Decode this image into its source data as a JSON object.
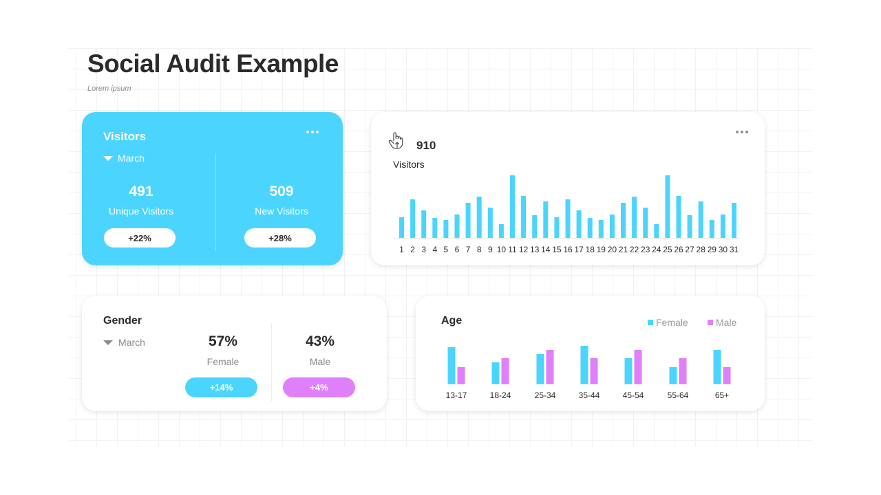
{
  "header": {
    "title": "Social Audit Example",
    "subtitle": "Lorem ipsum"
  },
  "colors": {
    "cyan": "#4bd5fe",
    "magenta": "#df80fa",
    "text_dark": "#2b2b2b",
    "text_muted": "#8a8a8a"
  },
  "visitors_card": {
    "title": "Visitors",
    "month": "March",
    "menu_icon": "more-horizontal-icon",
    "unique": {
      "value": "491",
      "label": "Unique Visitors",
      "change": "+22%"
    },
    "new": {
      "value": "509",
      "label": "New Visitors",
      "change": "+28%"
    }
  },
  "daily_card": {
    "icon": "hand-pointer-up-icon",
    "total": "910",
    "label": "Visitors",
    "menu_icon": "more-horizontal-icon"
  },
  "gender_card": {
    "title": "Gender",
    "month": "March",
    "female": {
      "value": "57%",
      "label": "Female",
      "change": "+14%"
    },
    "male": {
      "value": "43%",
      "label": "Male",
      "change": "+4%"
    }
  },
  "age_card": {
    "title": "Age",
    "legend": [
      {
        "label": "Female",
        "color": "#4bd5fe"
      },
      {
        "label": "Male",
        "color": "#df80fa"
      }
    ]
  },
  "chart_data": [
    {
      "type": "bar",
      "title": "Visitors",
      "xlabel": "",
      "ylabel": "",
      "categories": [
        "1",
        "2",
        "3",
        "4",
        "5",
        "6",
        "7",
        "8",
        "9",
        "10",
        "11",
        "12",
        "13",
        "14",
        "15",
        "16",
        "17",
        "18",
        "19",
        "20",
        "21",
        "22",
        "23",
        "24",
        "25",
        "26",
        "27",
        "28",
        "29",
        "30",
        "31"
      ],
      "values": [
        30,
        56,
        40,
        29,
        26,
        34,
        51,
        60,
        44,
        20,
        91,
        61,
        33,
        53,
        30,
        56,
        40,
        29,
        26,
        34,
        51,
        60,
        44,
        20,
        91,
        61,
        33,
        53,
        26,
        34,
        51
      ],
      "ylim": [
        0,
        91
      ],
      "grid": false,
      "color": "#4bd5fe"
    },
    {
      "type": "bar",
      "title": "Age",
      "xlabel": "",
      "ylabel": "",
      "categories": [
        "13-17",
        "18-24",
        "25-34",
        "35-44",
        "45-54",
        "55-64",
        "65+"
      ],
      "series": [
        {
          "name": "Female",
          "color": "#4bd5fe",
          "values": [
            54,
            32,
            44,
            56,
            38,
            25,
            50
          ]
        },
        {
          "name": "Male",
          "color": "#df80fa",
          "values": [
            25,
            38,
            50,
            38,
            50,
            38,
            25
          ]
        }
      ],
      "ylim": [
        0,
        56
      ],
      "grid": false,
      "legend": "top-right"
    }
  ]
}
